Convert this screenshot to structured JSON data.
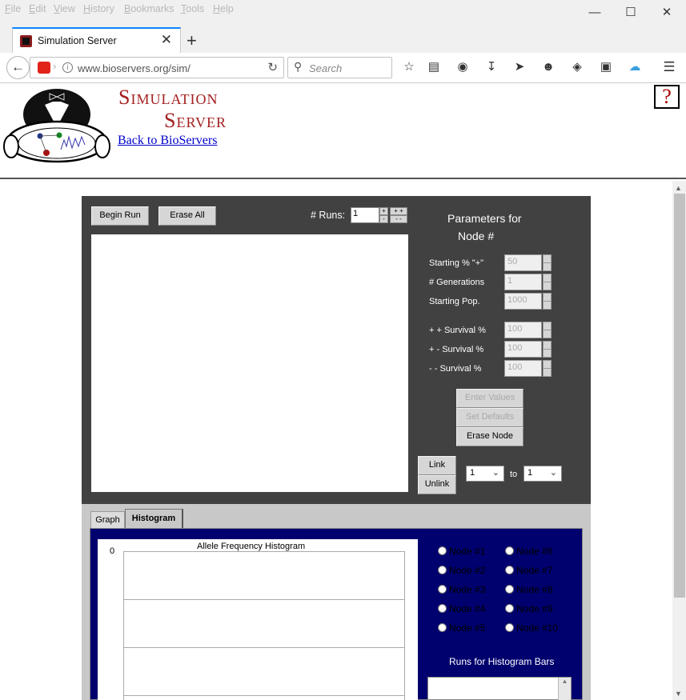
{
  "browser": {
    "menu": [
      "File",
      "Edit",
      "View",
      "History",
      "Bookmarks",
      "Tools",
      "Help"
    ],
    "tab_title": "Simulation Server",
    "url": "www.bioservers.org/sim/",
    "search_placeholder": "Search"
  },
  "site": {
    "title_line1": "Simulation",
    "title_line2": "Server",
    "back_link": "Back to BioServers",
    "help_symbol": "?"
  },
  "applet": {
    "begin_run": "Begin Run",
    "erase_all": "Erase All",
    "runs_label": "# Runs:",
    "runs_value": "1",
    "spin_plus": "+",
    "spin_minus": "-",
    "spin_plusplus": "+ +",
    "spin_minusminus": "- -",
    "params_title_1": "Parameters for",
    "params_title_2": "Node #",
    "params": [
      {
        "label": "Starting % \"+\"",
        "value": "50"
      },
      {
        "label": "# Generations",
        "value": "1"
      },
      {
        "label": "Starting Pop.",
        "value": "1000"
      },
      {
        "label": "+ + Survival %",
        "value": "100"
      },
      {
        "label": "+ -  Survival %",
        "value": "100"
      },
      {
        "label": "- -   Survival %",
        "value": "100"
      }
    ],
    "enter_values": "Enter Values",
    "set_defaults": "Set Defaults",
    "erase_node": "Erase Node",
    "link": "Link",
    "unlink": "Unlink",
    "from_node": "1",
    "to_label": "to",
    "to_node": "1"
  },
  "histogram": {
    "tab_graph": "Graph",
    "tab_histogram": "Histogram",
    "title": "Allele Frequency Histogram",
    "y_zero": "0",
    "nodes": [
      "Node #1",
      "Node #2",
      "Node #3",
      "Node #4",
      "Node #5",
      "Node #6",
      "Node #7",
      "Node #8",
      "Node #9",
      "Node #10"
    ],
    "runs_label": "Runs for Histogram Bars"
  },
  "colors": {
    "applet_bg": "#414141",
    "navy": "#00006e",
    "title_red": "#a52020",
    "accent": "#0a84ff"
  }
}
